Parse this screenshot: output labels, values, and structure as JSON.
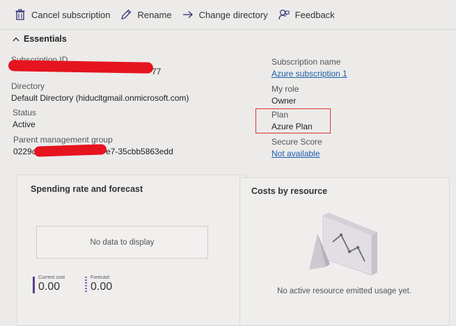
{
  "toolbar": {
    "cancel_label": "Cancel subscription",
    "rename_label": "Rename",
    "change_dir_label": "Change directory",
    "feedback_label": "Feedback"
  },
  "essentials": {
    "label": "Essentials"
  },
  "left_fields": {
    "subscription_id_label": "Subscription ID",
    "subscription_id_visible_end": "77",
    "directory_label": "Directory",
    "directory_value": "Default Directory (hiducltgmail.onmicrosoft.com)",
    "status_label": "Status",
    "status_value": "Active",
    "parent_group_label": "Parent management group",
    "parent_group_start": "0229c",
    "parent_group_end": "e7-35cbb5863edd"
  },
  "right_fields": {
    "subscription_name_label": "Subscription name",
    "subscription_name_value": "Azure subscription 1",
    "my_role_label": "My role",
    "my_role_value": "Owner",
    "plan_label": "Plan",
    "plan_value": "Azure Plan",
    "secure_score_label": "Secure Score",
    "secure_score_value": "Not available"
  },
  "spending_card": {
    "title": "Spending rate and forecast",
    "no_data": "No data to display",
    "current_cost_label": "Current cost",
    "current_cost_value": "0.00",
    "forecast_label": "Forecast",
    "forecast_value": "0.00"
  },
  "costs_card": {
    "title": "Costs by resource",
    "empty_message": "No active resource emitted usage yet."
  },
  "colors": {
    "accent_link": "#1c5ea8",
    "highlight_box": "#d9322f",
    "current_cost_bar": "#5b3e8d",
    "forecast_bar": "#8c6bbd"
  }
}
